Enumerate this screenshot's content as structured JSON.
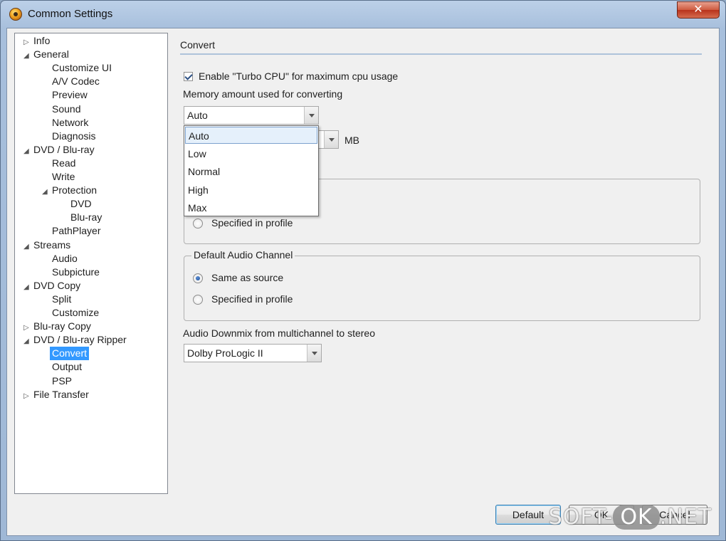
{
  "window": {
    "title": "Common Settings",
    "close_symbol": "✕"
  },
  "tree": {
    "items": [
      {
        "label": "Info",
        "expander": "▷"
      },
      {
        "label": "General",
        "expander": "◢"
      },
      {
        "label": "Customize UI",
        "expander": ""
      },
      {
        "label": "A/V Codec",
        "expander": ""
      },
      {
        "label": "Preview",
        "expander": ""
      },
      {
        "label": "Sound",
        "expander": ""
      },
      {
        "label": "Network",
        "expander": ""
      },
      {
        "label": "Diagnosis",
        "expander": ""
      },
      {
        "label": "DVD / Blu-ray",
        "expander": "◢"
      },
      {
        "label": "Read",
        "expander": ""
      },
      {
        "label": "Write",
        "expander": ""
      },
      {
        "label": "Protection",
        "expander": "◢"
      },
      {
        "label": "DVD",
        "expander": ""
      },
      {
        "label": "Blu-ray",
        "expander": ""
      },
      {
        "label": "PathPlayer",
        "expander": ""
      },
      {
        "label": "Streams",
        "expander": "◢"
      },
      {
        "label": "Audio",
        "expander": ""
      },
      {
        "label": "Subpicture",
        "expander": ""
      },
      {
        "label": "DVD Copy",
        "expander": "◢"
      },
      {
        "label": "Split",
        "expander": ""
      },
      {
        "label": "Customize",
        "expander": ""
      },
      {
        "label": "Blu-ray Copy",
        "expander": "▷"
      },
      {
        "label": "DVD / Blu-ray Ripper",
        "expander": "◢"
      },
      {
        "label": "Convert",
        "expander": "",
        "selected": true
      },
      {
        "label": "Output",
        "expander": ""
      },
      {
        "label": "PSP",
        "expander": ""
      },
      {
        "label": "File Transfer",
        "expander": "▷"
      }
    ]
  },
  "convert": {
    "section_title": "Convert",
    "turbo_cpu_label": "Enable \"Turbo CPU\" for maximum cpu usage",
    "turbo_cpu_checked": true,
    "memory_label": "Memory amount used for converting",
    "memory_value": "Auto",
    "memory_options": [
      "Auto",
      "Low",
      "Normal",
      "High",
      "Max"
    ],
    "memory_unit": "MB"
  },
  "group1": {
    "option2": "Specified in profile"
  },
  "audio_channel": {
    "legend": "Default Audio Channel",
    "option1": "Same as source",
    "option2": "Specified in profile",
    "selected": "Same as source"
  },
  "downmix": {
    "label": "Audio Downmix from multichannel to stereo",
    "value": "Dolby ProLogic II"
  },
  "buttons": {
    "default": "Default",
    "ok": "OK",
    "cancel": "Cancel"
  },
  "watermark": {
    "part1": "SOFT-",
    "part2": "OK",
    "part3": ".NET"
  }
}
